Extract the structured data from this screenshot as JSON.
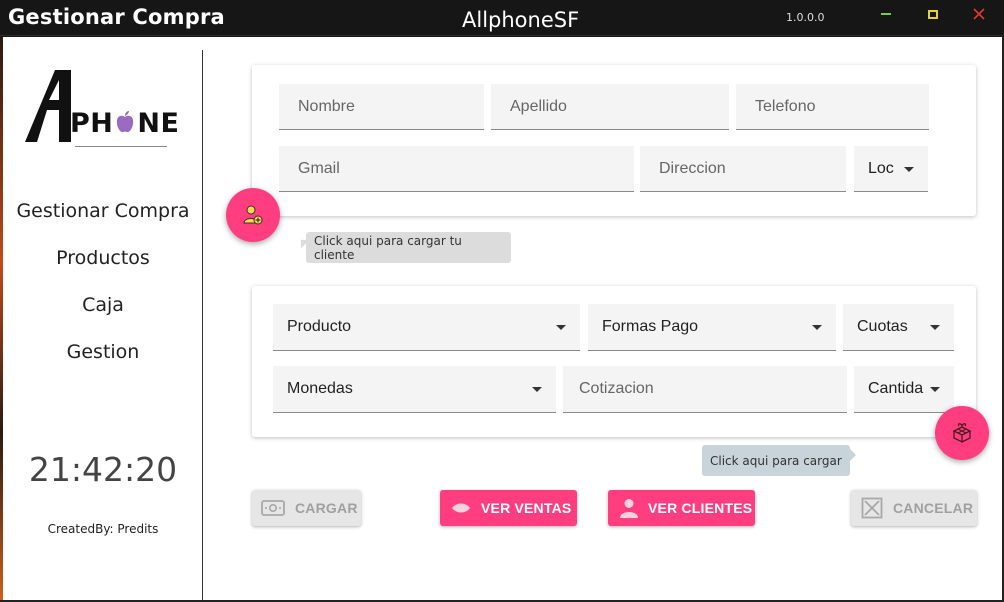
{
  "window": {
    "title": "Gestionar Compra",
    "center_title": "AllphoneSF",
    "version": "1.0.0.0",
    "colors": {
      "minimize": "#6fd04a",
      "maximize": "#e6d232",
      "close": "#e03a2a"
    }
  },
  "sidebar": {
    "logo": {
      "letter": "A",
      "text_before": "PH",
      "text_after": "NE",
      "apple_color": "#9b6bbf"
    },
    "items": [
      {
        "label": "Gestionar Compra"
      },
      {
        "label": "Productos"
      },
      {
        "label": "Caja"
      },
      {
        "label": "Gestion"
      }
    ],
    "clock": "21:42:20",
    "created_by": "CreatedBy: Predits"
  },
  "client_form": {
    "nombre": {
      "placeholder": "Nombre"
    },
    "apellido": {
      "placeholder": "Apellido"
    },
    "telefono": {
      "placeholder": "Telefono"
    },
    "gmail": {
      "placeholder": "Gmail"
    },
    "direccion": {
      "placeholder": "Direccion"
    },
    "localidad": {
      "value": "Loc"
    },
    "add_client_icon": "add-user-icon",
    "tooltip": "Click aqui para cargar tu cliente"
  },
  "product_form": {
    "producto": {
      "value": "Producto"
    },
    "formas_pago": {
      "value": "Formas Pago"
    },
    "cuotas": {
      "value": "Cuotas"
    },
    "monedas": {
      "value": "Monedas"
    },
    "cotizacion": {
      "placeholder": "Cotizacion"
    },
    "cantidad": {
      "value": "Cantida"
    },
    "load_icon": "gift-box-icon",
    "tooltip": "Click aqui para cargar"
  },
  "actions": {
    "cargar": "CARGAR",
    "ver_ventas": "VER VENTAS",
    "ver_clientes": "VER CLIENTES",
    "cancelar": "CANCELAR",
    "accent": "#ff3d7f"
  }
}
